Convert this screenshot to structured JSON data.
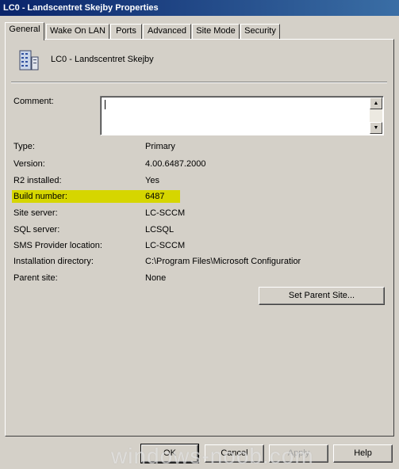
{
  "window": {
    "title": "LC0 - Landscentret Skejby Properties"
  },
  "tabs": [
    {
      "label": "General"
    },
    {
      "label": "Wake On LAN"
    },
    {
      "label": "Ports"
    },
    {
      "label": "Advanced"
    },
    {
      "label": "Site Mode"
    },
    {
      "label": "Security"
    }
  ],
  "site": {
    "name": "LC0 - Landscentret Skejby"
  },
  "comment": {
    "label": "Comment:",
    "value": ""
  },
  "properties": [
    {
      "label": "Type:",
      "value": "Primary"
    },
    {
      "label": "Version:",
      "value": "4.00.6487.2000"
    },
    {
      "label": "R2 installed:",
      "value": "Yes"
    },
    {
      "label": "Build number:",
      "value": "6487"
    },
    {
      "label": "Site server:",
      "value": "LC-SCCM"
    },
    {
      "label": "SQL server:",
      "value": "LCSQL"
    },
    {
      "label": "SMS Provider location:",
      "value": "LC-SCCM"
    },
    {
      "label": "Installation directory:",
      "value": "C:\\Program Files\\Microsoft Configuratior"
    },
    {
      "label": "Parent site:",
      "value": "None"
    }
  ],
  "buttons": {
    "set_parent_site": "Set Parent Site...",
    "ok": "OK",
    "cancel": "Cancel",
    "apply": "Apply",
    "help": "Help"
  },
  "highlight_color": "#d6d600",
  "watermark": "windows-noob.com"
}
